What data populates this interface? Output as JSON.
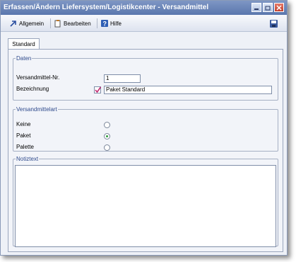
{
  "window": {
    "title": "Erfassen/Ändern Liefersystem/Logistikcenter - Versandmittel"
  },
  "toolbar": {
    "allgemein": "Allgemein",
    "bearbeiten": "Bearbeiten",
    "hilfe": "Hilfe"
  },
  "tabs": [
    {
      "label": "Standard",
      "selected": true
    }
  ],
  "daten": {
    "legend": "Daten",
    "nr_label": "Versandmittel-Nr.",
    "nr_value": "1",
    "bez_label": "Bezeichnung",
    "bez_value": "Paket Standard"
  },
  "versandmittelart": {
    "legend": "Versandmittelart",
    "options": [
      {
        "label": "Keine",
        "selected": false
      },
      {
        "label": "Paket",
        "selected": true
      },
      {
        "label": "Palette",
        "selected": false
      }
    ]
  },
  "notiz": {
    "legend": "Notiztext",
    "value": ""
  },
  "colors": {
    "title_bar": "#6a84b8",
    "radio_selected": "#2c9a3c",
    "legend_text": "#2e4a8c"
  }
}
